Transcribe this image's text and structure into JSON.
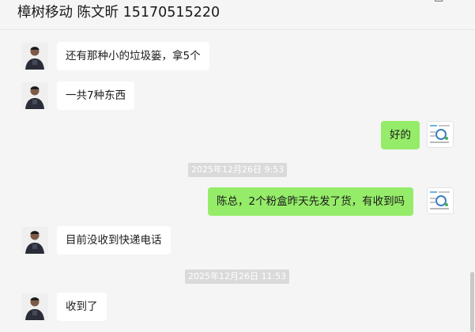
{
  "header": {
    "title": "樟树移动 陈文昕  15170515220",
    "controls": [
      "pin-icon",
      "minimize-icon",
      "maximize-icon",
      "close-icon"
    ]
  },
  "messages": [
    {
      "type": "in",
      "text": "还有那种小的垃圾篓，拿5个"
    },
    {
      "type": "in",
      "text": "一共7种东西"
    },
    {
      "type": "out",
      "text": "好的"
    },
    {
      "type": "time",
      "text": "2025年12月26日 9:53"
    },
    {
      "type": "out",
      "text": "陈总，2个粉盒昨天先发了货，有收到吗"
    },
    {
      "type": "in",
      "text": "目前没收到快递电话"
    },
    {
      "type": "time",
      "text": "2025年12月26日 11:53"
    },
    {
      "type": "in",
      "text": "收到了"
    }
  ]
}
